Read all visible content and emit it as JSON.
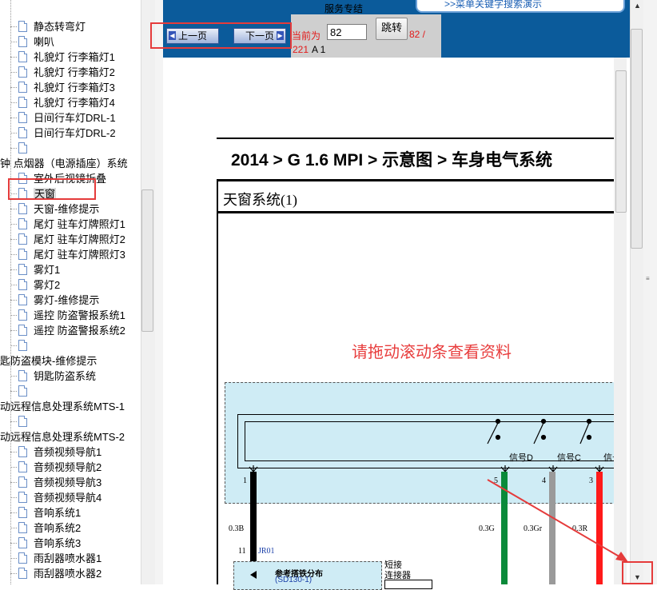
{
  "tree": {
    "items": [
      {
        "label": "静态转弯灯",
        "indent": 1
      },
      {
        "label": "喇叭",
        "indent": 1
      },
      {
        "label": "礼貌灯 行李箱灯1",
        "indent": 1
      },
      {
        "label": "礼貌灯 行李箱灯2",
        "indent": 1
      },
      {
        "label": "礼貌灯 行李箱灯3",
        "indent": 1
      },
      {
        "label": "礼貌灯 行李箱灯4",
        "indent": 1
      },
      {
        "label": "日间行车灯DRL-1",
        "indent": 1
      },
      {
        "label": "日间行车灯DRL-2",
        "indent": 1
      },
      {
        "label": "",
        "indent": 1
      },
      {
        "label": "钟 点烟器（电源插座）系统",
        "indent": 0
      },
      {
        "label": "室外后视镜折叠",
        "indent": 1
      },
      {
        "label": "天窗",
        "indent": 1,
        "selected": true
      },
      {
        "label": "天窗-维修提示",
        "indent": 1
      },
      {
        "label": "尾灯 驻车灯牌照灯1",
        "indent": 1
      },
      {
        "label": "尾灯 驻车灯牌照灯2",
        "indent": 1
      },
      {
        "label": "尾灯 驻车灯牌照灯3",
        "indent": 1
      },
      {
        "label": "雾灯1",
        "indent": 1
      },
      {
        "label": "雾灯2",
        "indent": 1
      },
      {
        "label": "雾灯-维修提示",
        "indent": 1
      },
      {
        "label": "遥控 防盗警报系统1",
        "indent": 1
      },
      {
        "label": "遥控 防盗警报系统2",
        "indent": 1
      },
      {
        "label": "",
        "indent": 1
      },
      {
        "label": "匙防盗模块-维修提示",
        "indent": 0
      },
      {
        "label": "钥匙防盗系统",
        "indent": 1
      },
      {
        "label": "",
        "indent": 1
      },
      {
        "label": "动远程信息处理系统MTS-1",
        "indent": 0
      },
      {
        "label": "",
        "indent": 1
      },
      {
        "label": "动远程信息处理系统MTS-2",
        "indent": 0
      },
      {
        "label": "音频视频导航1",
        "indent": 1
      },
      {
        "label": "音频视频导航2",
        "indent": 1
      },
      {
        "label": "音频视频导航3",
        "indent": 1
      },
      {
        "label": "音频视频导航4",
        "indent": 1
      },
      {
        "label": "音响系统1",
        "indent": 1
      },
      {
        "label": "音响系统2",
        "indent": 1
      },
      {
        "label": "音响系统3",
        "indent": 1
      },
      {
        "label": "雨刮器喷水器1",
        "indent": 1
      },
      {
        "label": "雨刮器喷水器2",
        "indent": 1
      }
    ]
  },
  "header": {
    "service_text": "服务专结",
    "search_demo": ">>菜单关键字搜索演示"
  },
  "nav": {
    "prev_label": "上一页",
    "next_label": "下一页",
    "current_label": "当前为",
    "current_page": "82",
    "jump_label": "跳转",
    "page_fraction": "82 /",
    "total_pages": "221",
    "suffix": "A 1"
  },
  "doc": {
    "breadcrumb": "2014 > G 1.6 MPI > 示意图 > 车身电气系统",
    "section_title": "天窗系统(1)",
    "scroll_hint": "请拖动滚动条查看资料",
    "pin_labels": [
      "1",
      "5",
      "4",
      "3"
    ],
    "signals": [
      "信号D",
      "信号C",
      "信号"
    ],
    "wire_specs": [
      "0.3B",
      "0.3G",
      "0.3Gr",
      "0.3R"
    ],
    "connector_pin": "11",
    "connector_id": "JR01",
    "ground_title": "参考搭铁分布",
    "ground_ref": "(SD130-1)",
    "short_conn_1": "短接",
    "short_conn_2": "连接器",
    "colors": {
      "black": "#000000",
      "green": "#0a8a3a",
      "gray": "#9a9a9a",
      "red": "#ff1a1a",
      "accent": "#e53b3b",
      "nav_blue": "#0b5b9b"
    }
  }
}
